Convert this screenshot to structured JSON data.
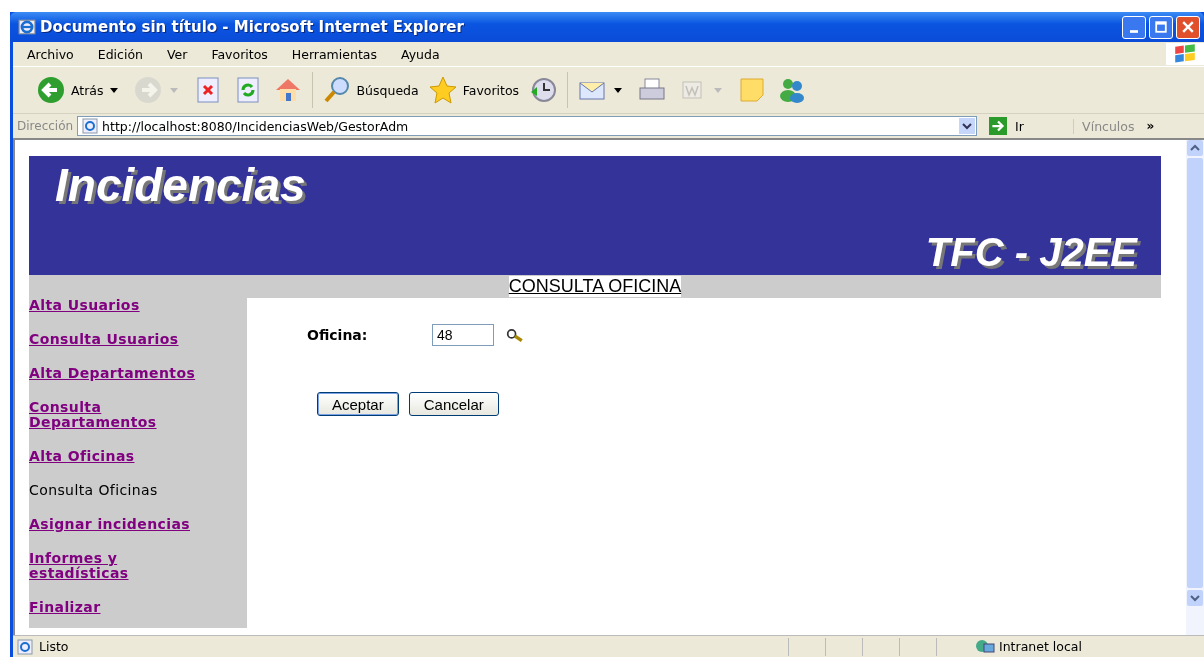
{
  "window": {
    "title": "Documento sin título - Microsoft Internet Explorer"
  },
  "menu": [
    "Archivo",
    "Edición",
    "Ver",
    "Favoritos",
    "Herramientas",
    "Ayuda"
  ],
  "toolbar": [
    {
      "kind": "back",
      "label": "Atrás",
      "disabled": false
    },
    {
      "kind": "forward",
      "disabled": true
    },
    {
      "kind": "stop",
      "disabled": false
    },
    {
      "kind": "refresh",
      "disabled": false
    },
    {
      "kind": "home",
      "disabled": false
    },
    {
      "kind": "search",
      "label": "Búsqueda",
      "disabled": false
    },
    {
      "kind": "favorites",
      "label": "Favoritos",
      "disabled": false
    },
    {
      "kind": "history",
      "disabled": false
    },
    {
      "kind": "mail",
      "disabled": false
    },
    {
      "kind": "print",
      "disabled": false
    },
    {
      "kind": "edit",
      "disabled": true
    },
    {
      "kind": "note",
      "disabled": false
    },
    {
      "kind": "messenger",
      "disabled": false
    }
  ],
  "address": {
    "label": "Dirección",
    "value": "http://localhost:8080/IncidenciasWeb/GestorAdm",
    "go": "Ir",
    "links": "Vínculos",
    "more": "»"
  },
  "page": {
    "banner_title": "Incidencias",
    "banner_subtitle": "TFC - J2EE",
    "heading": "CONSULTA OFICINA",
    "sidebar": [
      {
        "label": "Alta Usuarios",
        "selected": false
      },
      {
        "label": "Consulta Usuarios",
        "selected": false
      },
      {
        "label": "Alta Departamentos",
        "selected": false
      },
      {
        "label": "Consulta Departamentos",
        "selected": false
      },
      {
        "label": "Alta Oficinas",
        "selected": false
      },
      {
        "label": "Consulta Oficinas",
        "selected": true
      },
      {
        "label": "Asignar incidencias",
        "selected": false
      },
      {
        "label": "Informes y estadísticas",
        "selected": false
      },
      {
        "label": "Finalizar",
        "selected": false
      }
    ],
    "form": {
      "label": "Oficina:",
      "value": "48"
    },
    "buttons": [
      "Aceptar",
      "Cancelar"
    ]
  },
  "status_bar": {
    "text": "Listo",
    "zone": "Intranet local"
  }
}
